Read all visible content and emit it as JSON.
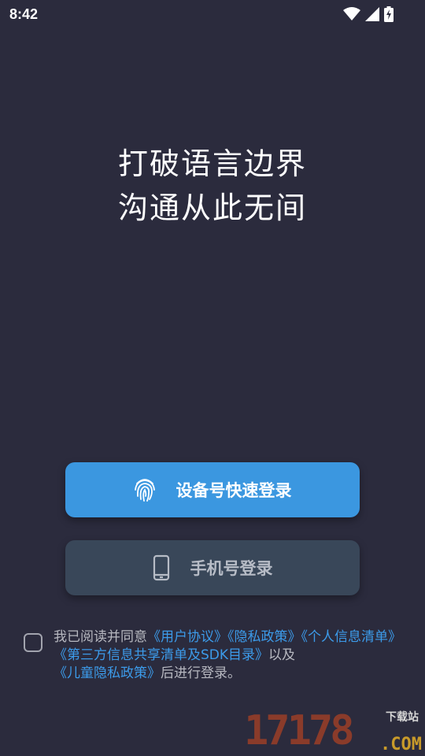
{
  "status_bar": {
    "time": "8:42"
  },
  "hero": {
    "line1": "打破语言边界",
    "line2": "沟通从此无间"
  },
  "buttons": {
    "device_login": "设备号快速登录",
    "phone_login": "手机号登录"
  },
  "agreement": {
    "prefix": "我已阅读并同意",
    "user_agreement": "《用户协议》",
    "privacy_policy": "《隐私政策》",
    "personal_info_list": "《个人信息清单》",
    "third_party_list": "《第三方信息共享清单及SDK目录》",
    "connector": "以及",
    "children_privacy": "《儿童隐私政策》",
    "suffix": "后进行登录。"
  },
  "watermark": {
    "number": "17178",
    "tag": "下载站",
    "domain": ".COM"
  },
  "colors": {
    "background": "#2b2b3d",
    "primary": "#3b97e0",
    "secondary": "#394759",
    "link": "#3c9bea"
  }
}
